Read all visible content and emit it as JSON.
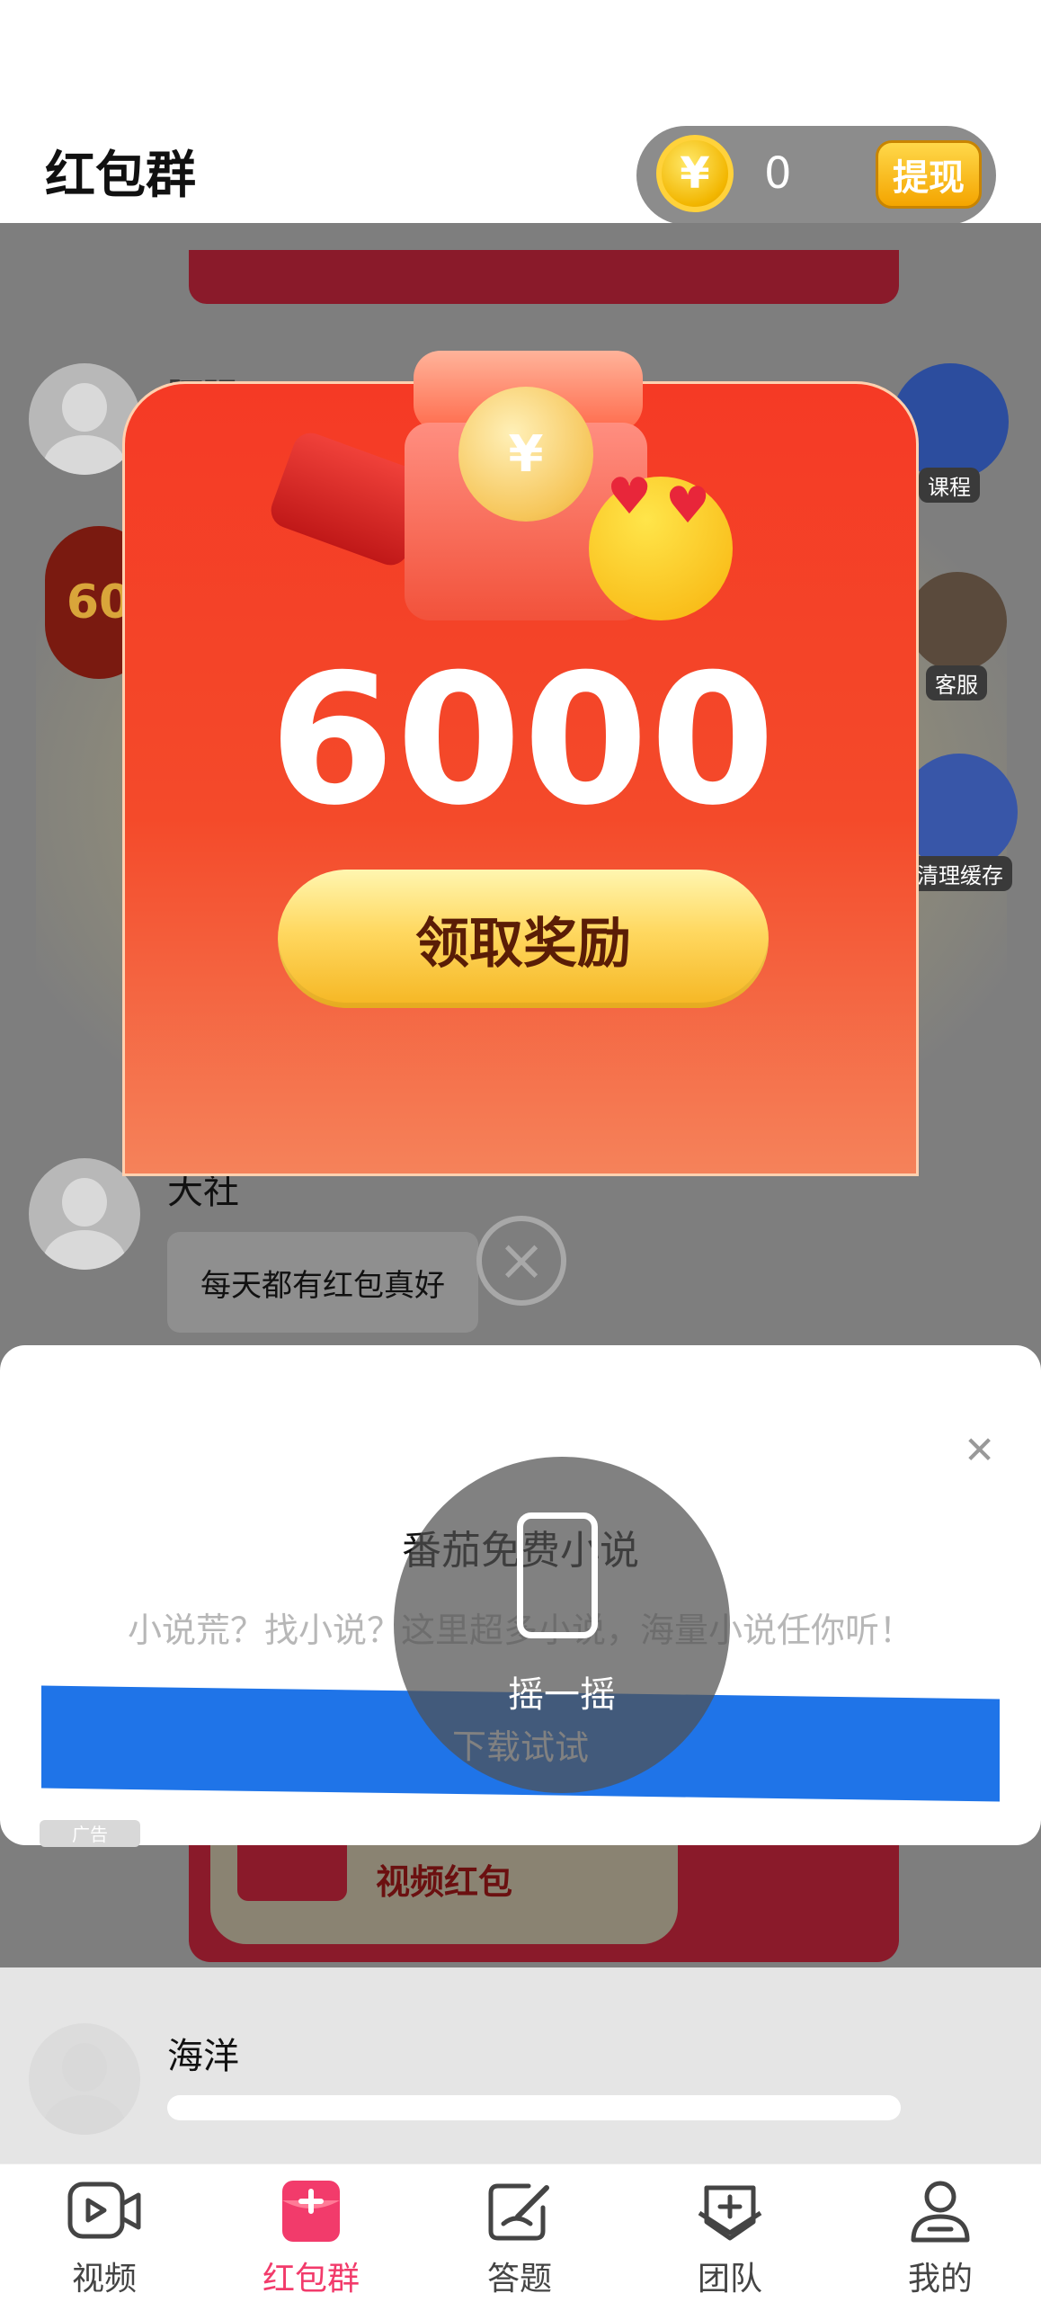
{
  "header": {
    "title": "红包群",
    "coin_symbol": "¥",
    "coin_count": "0",
    "withdraw_label": "提现"
  },
  "chat": {
    "names": [
      "阿强",
      "大社",
      "海洋"
    ],
    "bubble_text": "每天都有红包真好",
    "badge_60": "60",
    "side_buttons": [
      "课程",
      "客服",
      "清理缓存"
    ],
    "video_redpacket_label": "视频红包"
  },
  "reward_popup": {
    "amount": "6000",
    "claim_label": "领取奖励",
    "coin_symbol": "¥"
  },
  "ad": {
    "app_name": "番茄免费小说",
    "description": "小说荒？找小说？这里超多小说，海量小说任你听！",
    "download_label": "下载试试",
    "shake_label": "摇一摇",
    "ad_tag": "广告"
  },
  "tabbar": {
    "items": [
      {
        "label": "视频",
        "icon": "video-icon"
      },
      {
        "label": "红包群",
        "icon": "redpacket-icon"
      },
      {
        "label": "答题",
        "icon": "quiz-icon"
      },
      {
        "label": "团队",
        "icon": "team-icon"
      },
      {
        "label": "我的",
        "icon": "profile-icon"
      }
    ],
    "active_index": 1,
    "active_color": "#f23b6b"
  }
}
